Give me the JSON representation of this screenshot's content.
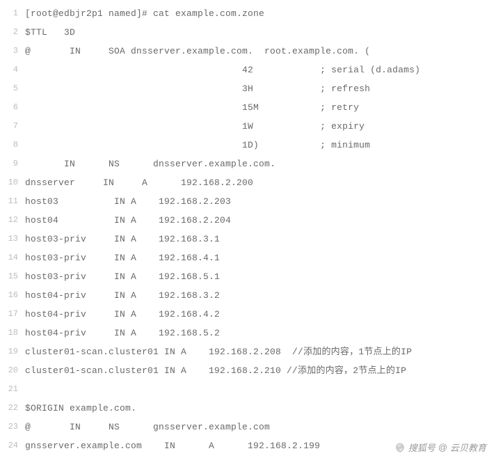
{
  "lines": [
    "[root@edbjr2p1 named]# cat example.com.zone",
    "$TTL   3D",
    "@       IN     SOA dnsserver.example.com.  root.example.com. (",
    "                                       42            ; serial (d.adams)",
    "                                       3H            ; refresh",
    "                                       15M           ; retry",
    "                                       1W            ; expiry",
    "                                       1D)           ; minimum",
    "       IN      NS      dnsserver.example.com.",
    "dnsserver     IN     A      192.168.2.200",
    "host03          IN A    192.168.2.203",
    "host04          IN A    192.168.2.204",
    "host03-priv     IN A    192.168.3.1",
    "host03-priv     IN A    192.168.4.1",
    "host03-priv     IN A    192.168.5.1",
    "host04-priv     IN A    192.168.3.2",
    "host04-priv     IN A    192.168.4.2",
    "host04-priv     IN A    192.168.5.2",
    "cluster01-scan.cluster01 IN A    192.168.2.208  //添加的内容，1节点上的IP",
    "cluster01-scan.cluster01 IN A    192.168.2.210 //添加的内容，2节点上的IP",
    "",
    "$ORIGIN example.com.",
    "@       IN     NS      gnsserver.example.com",
    "gnsserver.example.com    IN      A      192.168.2.199"
  ],
  "watermark": {
    "label": "搜狐号",
    "at": "@",
    "name": "云贝教育"
  }
}
